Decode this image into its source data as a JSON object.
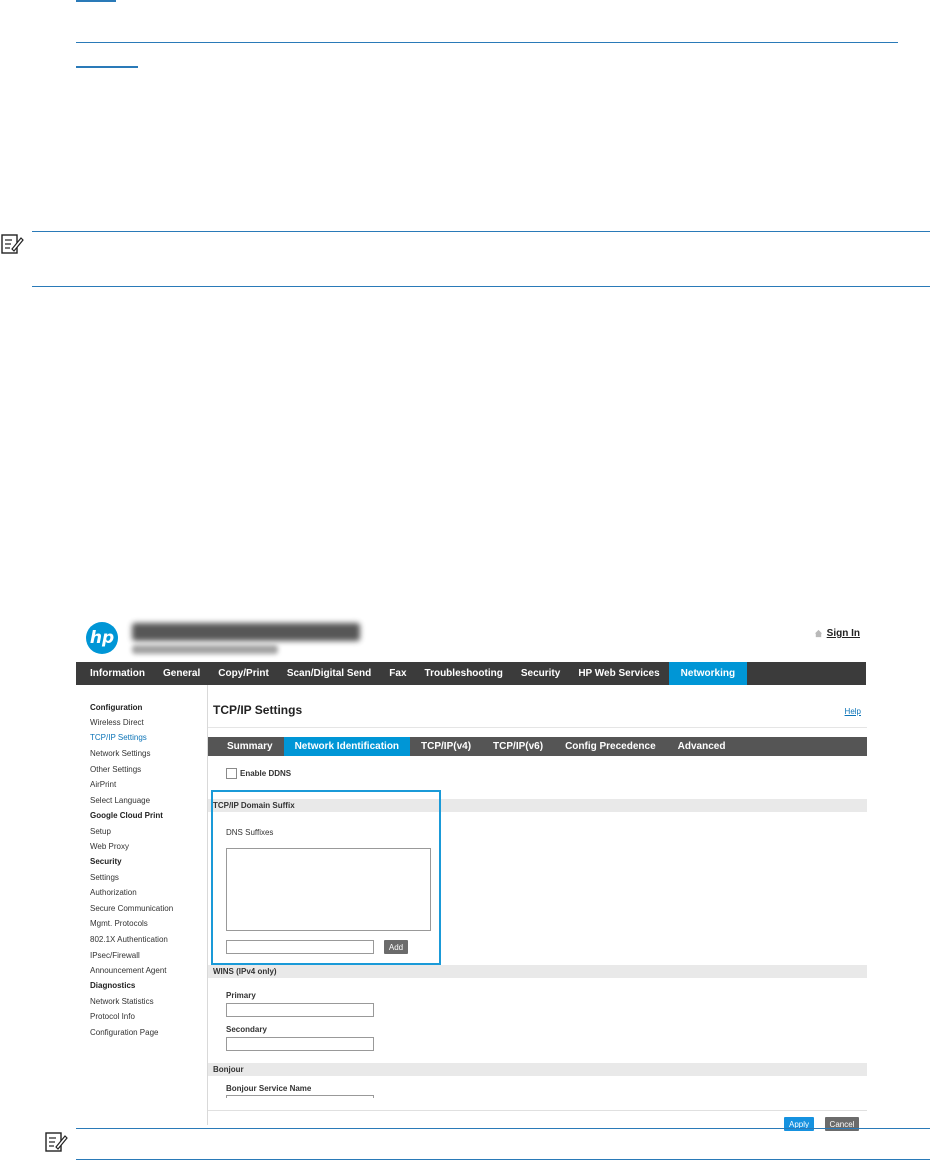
{
  "app": {
    "name": "HP Embedded Web Server",
    "sign_in": "Sign In",
    "help": "Help"
  },
  "main_nav": [
    {
      "label": "Information",
      "active": false
    },
    {
      "label": "General",
      "active": false
    },
    {
      "label": "Copy/Print",
      "active": false
    },
    {
      "label": "Scan/Digital Send",
      "active": false
    },
    {
      "label": "Fax",
      "active": false
    },
    {
      "label": "Troubleshooting",
      "active": false
    },
    {
      "label": "Security",
      "active": false
    },
    {
      "label": "HP Web Services",
      "active": false
    },
    {
      "label": "Networking",
      "active": true
    }
  ],
  "sidebar": [
    {
      "label": "Configuration",
      "type": "head"
    },
    {
      "label": "Wireless Direct",
      "type": "item"
    },
    {
      "label": "TCP/IP Settings",
      "type": "active"
    },
    {
      "label": "Network Settings",
      "type": "item"
    },
    {
      "label": "Other Settings",
      "type": "item"
    },
    {
      "label": "AirPrint",
      "type": "item"
    },
    {
      "label": "Select Language",
      "type": "item"
    },
    {
      "label": "Google Cloud Print",
      "type": "head"
    },
    {
      "label": "Setup",
      "type": "item"
    },
    {
      "label": "Web Proxy",
      "type": "item"
    },
    {
      "label": "Security",
      "type": "head"
    },
    {
      "label": "Settings",
      "type": "item"
    },
    {
      "label": "Authorization",
      "type": "item"
    },
    {
      "label": "Secure Communication",
      "type": "item"
    },
    {
      "label": "Mgmt. Protocols",
      "type": "item"
    },
    {
      "label": "802.1X Authentication",
      "type": "item"
    },
    {
      "label": "IPsec/Firewall",
      "type": "item"
    },
    {
      "label": "Announcement Agent",
      "type": "item"
    },
    {
      "label": "Diagnostics",
      "type": "head"
    },
    {
      "label": "Network Statistics",
      "type": "item"
    },
    {
      "label": "Protocol Info",
      "type": "item"
    },
    {
      "label": "Configuration Page",
      "type": "item"
    }
  ],
  "page": {
    "title": "TCP/IP Settings",
    "sub_tabs": [
      {
        "label": "Summary",
        "active": false
      },
      {
        "label": "Network Identification",
        "active": true
      },
      {
        "label": "TCP/IP(v4)",
        "active": false
      },
      {
        "label": "TCP/IP(v6)",
        "active": false
      },
      {
        "label": "Config Precedence",
        "active": false
      },
      {
        "label": "Advanced",
        "active": false
      }
    ],
    "enable_ddns": {
      "label": "Enable DDNS",
      "checked": false
    },
    "domain_suffix": {
      "section_title": "TCP/IP Domain Suffix",
      "label": "DNS Suffixes",
      "input_value": "",
      "add_button": "Add"
    },
    "wins": {
      "section_title": "WINS (IPv4 only)",
      "primary_label": "Primary",
      "primary_value": "",
      "secondary_label": "Secondary",
      "secondary_value": ""
    },
    "bonjour": {
      "section_title": "Bonjour",
      "service_name_label": "Bonjour Service Name"
    },
    "apply_button": "Apply",
    "cancel_button": "Cancel"
  },
  "colors": {
    "hp_blue": "#0096d6",
    "nav_dark": "#3b3b3b",
    "subnav_gray": "#555555",
    "link_blue": "#0c74b8",
    "rule_blue": "#2a7ab8"
  }
}
